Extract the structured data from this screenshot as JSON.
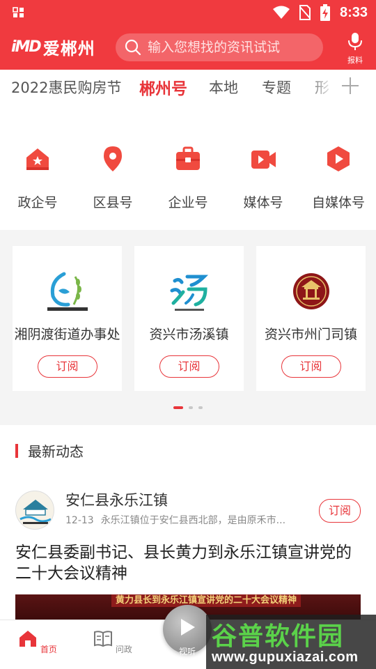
{
  "status_bar": {
    "time": "8:33"
  },
  "header": {
    "logo_mark": "iMD",
    "logo_text": "爱郴州",
    "search_placeholder": "输入您想找的资讯试试",
    "report_label": "报料"
  },
  "tabs": [
    {
      "label": "2022惠民购房节",
      "active": false
    },
    {
      "label": "郴州号",
      "active": true
    },
    {
      "label": "本地",
      "active": false
    },
    {
      "label": "专题",
      "active": false
    },
    {
      "label": "形",
      "active": false
    }
  ],
  "categories": [
    {
      "label": "政企号",
      "icon": "gov-house-icon"
    },
    {
      "label": "区县号",
      "icon": "location-pin-icon"
    },
    {
      "label": "企业号",
      "icon": "briefcase-icon"
    },
    {
      "label": "媒体号",
      "icon": "video-camera-icon"
    },
    {
      "label": "自媒体号",
      "icon": "play-hexagon-icon"
    }
  ],
  "cards": [
    {
      "title": "湘阴渡街道办事处",
      "logo_text": "湘阴渡街道办事处",
      "subscribe_label": "订阅"
    },
    {
      "title": "资兴市汤溪镇",
      "logo_text": "资兴市汤溪镇",
      "subscribe_label": "订阅"
    },
    {
      "title": "资兴市州门司镇",
      "logo_text": "资兴市州门司镇",
      "subscribe_label": "订阅"
    }
  ],
  "latest": {
    "section_title": "最新动态",
    "item": {
      "name": "安仁县永乐江镇",
      "date": "12-13",
      "summary": "永乐江镇位于安仁县西北部，是由原禾市...",
      "subscribe_label": "订阅",
      "headline": "安仁县委副书记、县长黄力到永乐江镇宣讲党的二十大会议精神",
      "thumb_banner": "黄力县长到永乐江镇宣讲党的二十大会议精神"
    }
  },
  "bottom_nav": [
    {
      "label": "首页",
      "active": true
    },
    {
      "label": "问政",
      "active": false
    }
  ],
  "listen_label": "视听",
  "watermark": {
    "title": "谷普软件园",
    "url": "www.gupuxiazai.com"
  },
  "colors": {
    "brand_red": "#f03a3f",
    "accent": "#e8353a"
  }
}
